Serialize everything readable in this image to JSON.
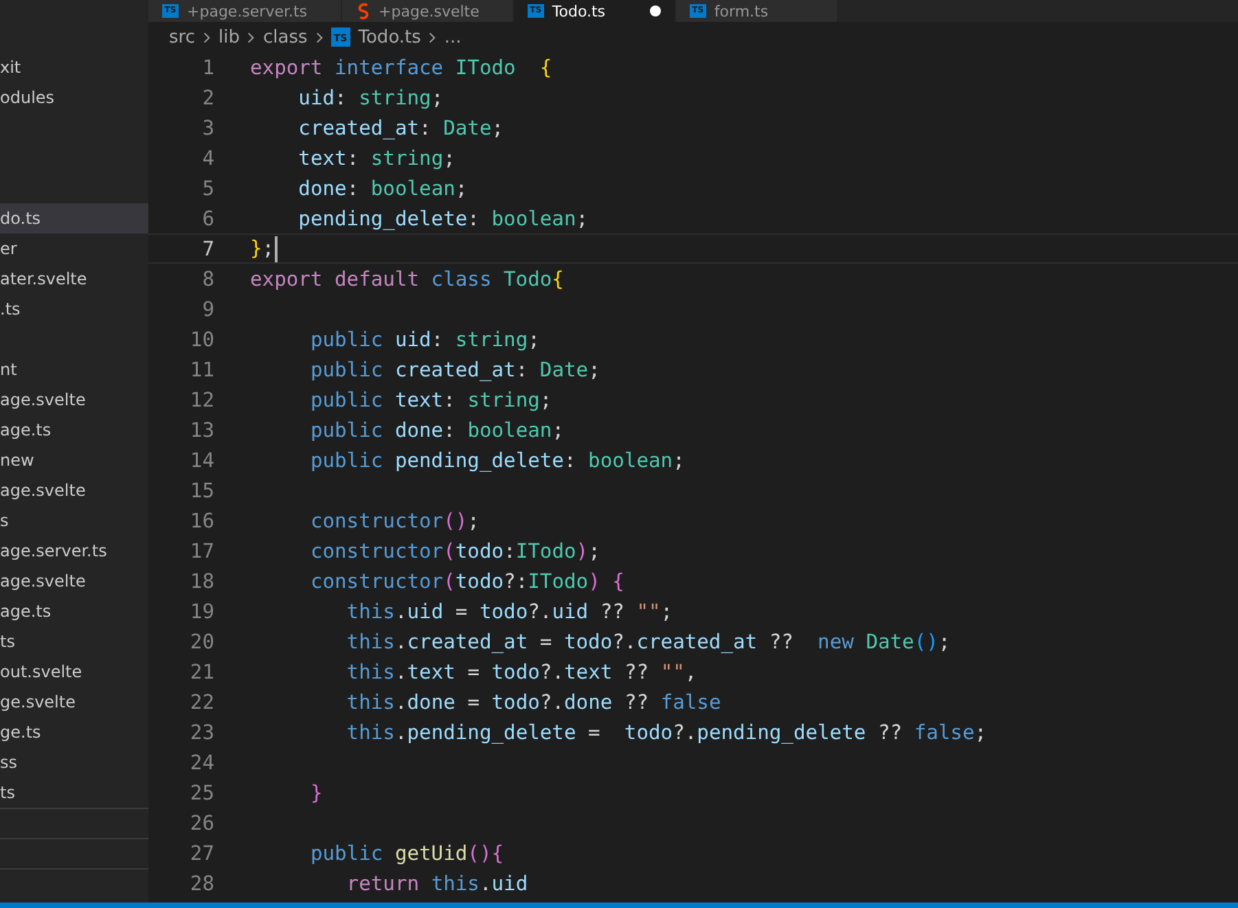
{
  "tabs": [
    {
      "label": "+page.server.ts",
      "kind": "ts",
      "icon_label": "TS",
      "selected": false,
      "modified": false
    },
    {
      "label": "+page.svelte",
      "kind": "svelte",
      "selected": false,
      "modified": false
    },
    {
      "label": "Todo.ts",
      "kind": "ts",
      "icon_label": "TS",
      "selected": true,
      "modified": true
    },
    {
      "label": "form.ts",
      "kind": "ts",
      "icon_label": "TS",
      "selected": false,
      "modified": false
    }
  ],
  "breadcrumb": [
    {
      "label": "src",
      "kind": "folder"
    },
    {
      "label": "lib",
      "kind": "folder"
    },
    {
      "label": "class",
      "kind": "folder"
    },
    {
      "label": "Todo.ts",
      "kind": "ts",
      "icon_label": "TS"
    },
    {
      "label": "...",
      "kind": "more"
    }
  ],
  "sidebar": {
    "items": [
      {
        "kind": "file",
        "label": "xit",
        "selected": false
      },
      {
        "kind": "file",
        "label": "odules",
        "selected": false
      },
      {
        "kind": "blank"
      },
      {
        "kind": "blank"
      },
      {
        "kind": "blank"
      },
      {
        "kind": "file",
        "label": "do.ts",
        "selected": true
      },
      {
        "kind": "file",
        "label": "er",
        "selected": false
      },
      {
        "kind": "file",
        "label": "ater.svelte",
        "selected": false
      },
      {
        "kind": "file",
        "label": ".ts",
        "selected": false
      },
      {
        "kind": "blank"
      },
      {
        "kind": "file",
        "label": "nt",
        "selected": false
      },
      {
        "kind": "file",
        "label": "age.svelte",
        "selected": false
      },
      {
        "kind": "file",
        "label": "age.ts",
        "selected": false
      },
      {
        "kind": "file",
        "label": "new",
        "selected": false
      },
      {
        "kind": "file",
        "label": "age.svelte",
        "selected": false
      },
      {
        "kind": "file",
        "label": "s",
        "selected": false
      },
      {
        "kind": "file",
        "label": "age.server.ts",
        "selected": false
      },
      {
        "kind": "file",
        "label": "age.svelte",
        "selected": false
      },
      {
        "kind": "file",
        "label": "age.ts",
        "selected": false
      },
      {
        "kind": "file",
        "label": "ts",
        "selected": false
      },
      {
        "kind": "file",
        "label": "out.svelte",
        "selected": false
      },
      {
        "kind": "file",
        "label": "ge.svelte",
        "selected": false
      },
      {
        "kind": "file",
        "label": "ge.ts",
        "selected": false
      },
      {
        "kind": "file",
        "label": "ss",
        "selected": false
      },
      {
        "kind": "file",
        "label": "ts",
        "selected": false
      }
    ]
  },
  "editor": {
    "lines": [
      {
        "number": "1",
        "current": false,
        "tokens": [
          {
            "text": "export ",
            "kind": "ctrl"
          },
          {
            "text": "interface ",
            "kind": "kw"
          },
          {
            "text": "ITodo  ",
            "kind": "type"
          },
          {
            "text": "{",
            "kind": "brace1"
          }
        ]
      },
      {
        "number": "2",
        "current": false,
        "tokens": [
          {
            "text": "    uid",
            "kind": "prop"
          },
          {
            "text": ": ",
            "kind": "plain"
          },
          {
            "text": "string",
            "kind": "type"
          },
          {
            "text": ";",
            "kind": "plain"
          }
        ]
      },
      {
        "number": "3",
        "current": false,
        "tokens": [
          {
            "text": "    created_at",
            "kind": "prop"
          },
          {
            "text": ": ",
            "kind": "plain"
          },
          {
            "text": "Date",
            "kind": "type"
          },
          {
            "text": ";",
            "kind": "plain"
          }
        ]
      },
      {
        "number": "4",
        "current": false,
        "tokens": [
          {
            "text": "    text",
            "kind": "prop"
          },
          {
            "text": ": ",
            "kind": "plain"
          },
          {
            "text": "string",
            "kind": "type"
          },
          {
            "text": ";",
            "kind": "plain"
          }
        ]
      },
      {
        "number": "5",
        "current": false,
        "tokens": [
          {
            "text": "    done",
            "kind": "prop"
          },
          {
            "text": ": ",
            "kind": "plain"
          },
          {
            "text": "boolean",
            "kind": "type"
          },
          {
            "text": ";",
            "kind": "plain"
          }
        ]
      },
      {
        "number": "6",
        "current": false,
        "tokens": [
          {
            "text": "    pending_delete",
            "kind": "prop"
          },
          {
            "text": ": ",
            "kind": "plain"
          },
          {
            "text": "boolean",
            "kind": "type"
          },
          {
            "text": ";",
            "kind": "plain"
          }
        ]
      },
      {
        "number": "7",
        "current": true,
        "tokens": [
          {
            "text": "}",
            "kind": "brace1"
          },
          {
            "text": ";",
            "kind": "plain"
          }
        ]
      },
      {
        "number": "8",
        "current": false,
        "tokens": [
          {
            "text": "export default ",
            "kind": "ctrl"
          },
          {
            "text": "class ",
            "kind": "kw"
          },
          {
            "text": "Todo",
            "kind": "type"
          },
          {
            "text": "{",
            "kind": "brace1"
          }
        ]
      },
      {
        "number": "9",
        "current": false
      },
      {
        "number": "10",
        "current": false,
        "tokens": [
          {
            "text": "     public ",
            "kind": "kw"
          },
          {
            "text": "uid",
            "kind": "prop"
          },
          {
            "text": ": ",
            "kind": "plain"
          },
          {
            "text": "string",
            "kind": "type"
          },
          {
            "text": ";",
            "kind": "plain"
          }
        ]
      },
      {
        "number": "11",
        "current": false,
        "tokens": [
          {
            "text": "     public ",
            "kind": "kw"
          },
          {
            "text": "created_at",
            "kind": "prop"
          },
          {
            "text": ": ",
            "kind": "plain"
          },
          {
            "text": "Date",
            "kind": "type"
          },
          {
            "text": ";",
            "kind": "plain"
          }
        ]
      },
      {
        "number": "12",
        "current": false,
        "tokens": [
          {
            "text": "     public ",
            "kind": "kw"
          },
          {
            "text": "text",
            "kind": "prop"
          },
          {
            "text": ": ",
            "kind": "plain"
          },
          {
            "text": "string",
            "kind": "type"
          },
          {
            "text": ";",
            "kind": "plain"
          }
        ]
      },
      {
        "number": "13",
        "current": false,
        "tokens": [
          {
            "text": "     public ",
            "kind": "kw"
          },
          {
            "text": "done",
            "kind": "prop"
          },
          {
            "text": ": ",
            "kind": "plain"
          },
          {
            "text": "boolean",
            "kind": "type"
          },
          {
            "text": ";",
            "kind": "plain"
          }
        ]
      },
      {
        "number": "14",
        "current": false,
        "tokens": [
          {
            "text": "     public ",
            "kind": "kw"
          },
          {
            "text": "pending_delete",
            "kind": "prop"
          },
          {
            "text": ": ",
            "kind": "plain"
          },
          {
            "text": "boolean",
            "kind": "type"
          },
          {
            "text": ";",
            "kind": "plain"
          }
        ]
      },
      {
        "number": "15",
        "current": false
      },
      {
        "number": "16",
        "current": false,
        "tokens": [
          {
            "text": "     constructor",
            "kind": "kw"
          },
          {
            "text": "()",
            "kind": "brace2"
          },
          {
            "text": ";",
            "kind": "plain"
          }
        ]
      },
      {
        "number": "17",
        "current": false,
        "tokens": [
          {
            "text": "     constructor",
            "kind": "kw"
          },
          {
            "text": "(",
            "kind": "brace2"
          },
          {
            "text": "todo",
            "kind": "prop"
          },
          {
            "text": ":",
            "kind": "plain"
          },
          {
            "text": "ITodo",
            "kind": "type"
          },
          {
            "text": ")",
            "kind": "brace2"
          },
          {
            "text": ";",
            "kind": "plain"
          }
        ]
      },
      {
        "number": "18",
        "current": false,
        "tokens": [
          {
            "text": "     constructor",
            "kind": "kw"
          },
          {
            "text": "(",
            "kind": "brace2"
          },
          {
            "text": "todo",
            "kind": "prop"
          },
          {
            "text": "?:",
            "kind": "plain"
          },
          {
            "text": "ITodo",
            "kind": "type"
          },
          {
            "text": ") {",
            "kind": "brace2"
          }
        ]
      },
      {
        "number": "19",
        "current": false,
        "tokens": [
          {
            "text": "        this",
            "kind": "kw"
          },
          {
            "text": ".",
            "kind": "plain"
          },
          {
            "text": "uid",
            "kind": "prop"
          },
          {
            "text": " = ",
            "kind": "plain"
          },
          {
            "text": "todo",
            "kind": "prop"
          },
          {
            "text": "?.",
            "kind": "plain"
          },
          {
            "text": "uid",
            "kind": "prop"
          },
          {
            "text": " ?? ",
            "kind": "plain"
          },
          {
            "text": "\"\"",
            "kind": "str"
          },
          {
            "text": ";",
            "kind": "plain"
          }
        ]
      },
      {
        "number": "20",
        "current": false,
        "tokens": [
          {
            "text": "        this",
            "kind": "kw"
          },
          {
            "text": ".",
            "kind": "plain"
          },
          {
            "text": "created_at",
            "kind": "prop"
          },
          {
            "text": " = ",
            "kind": "plain"
          },
          {
            "text": "todo",
            "kind": "prop"
          },
          {
            "text": "?.",
            "kind": "plain"
          },
          {
            "text": "created_at",
            "kind": "prop"
          },
          {
            "text": " ??  ",
            "kind": "plain"
          },
          {
            "text": "new ",
            "kind": "kw"
          },
          {
            "text": "Date",
            "kind": "type"
          },
          {
            "text": "()",
            "kind": "brace3"
          },
          {
            "text": ";",
            "kind": "plain"
          }
        ]
      },
      {
        "number": "21",
        "current": false,
        "tokens": [
          {
            "text": "        this",
            "kind": "kw"
          },
          {
            "text": ".",
            "kind": "plain"
          },
          {
            "text": "text",
            "kind": "prop"
          },
          {
            "text": " = ",
            "kind": "plain"
          },
          {
            "text": "todo",
            "kind": "prop"
          },
          {
            "text": "?.",
            "kind": "plain"
          },
          {
            "text": "text",
            "kind": "prop"
          },
          {
            "text": " ?? ",
            "kind": "plain"
          },
          {
            "text": "\"\"",
            "kind": "str"
          },
          {
            "text": ",",
            "kind": "plain"
          }
        ]
      },
      {
        "number": "22",
        "current": false,
        "tokens": [
          {
            "text": "        this",
            "kind": "kw"
          },
          {
            "text": ".",
            "kind": "plain"
          },
          {
            "text": "done",
            "kind": "prop"
          },
          {
            "text": " = ",
            "kind": "plain"
          },
          {
            "text": "todo",
            "kind": "prop"
          },
          {
            "text": "?.",
            "kind": "plain"
          },
          {
            "text": "done",
            "kind": "prop"
          },
          {
            "text": " ?? ",
            "kind": "plain"
          },
          {
            "text": "false",
            "kind": "kw"
          }
        ]
      },
      {
        "number": "23",
        "current": false,
        "tokens": [
          {
            "text": "        this",
            "kind": "kw"
          },
          {
            "text": ".",
            "kind": "plain"
          },
          {
            "text": "pending_delete",
            "kind": "prop"
          },
          {
            "text": " =  ",
            "kind": "plain"
          },
          {
            "text": "todo",
            "kind": "prop"
          },
          {
            "text": "?.",
            "kind": "plain"
          },
          {
            "text": "pending_delete",
            "kind": "prop"
          },
          {
            "text": " ?? ",
            "kind": "plain"
          },
          {
            "text": "false",
            "kind": "kw"
          },
          {
            "text": ";",
            "kind": "plain"
          }
        ]
      },
      {
        "number": "24",
        "current": false
      },
      {
        "number": "25",
        "current": false,
        "tokens": [
          {
            "text": "     }",
            "kind": "brace2"
          }
        ]
      },
      {
        "number": "26",
        "current": false
      },
      {
        "number": "27",
        "current": false,
        "tokens": [
          {
            "text": "     public ",
            "kind": "kw"
          },
          {
            "text": "getUid",
            "kind": "func"
          },
          {
            "text": "()",
            "kind": "brace2"
          },
          {
            "text": "{",
            "kind": "brace2"
          }
        ]
      },
      {
        "number": "28",
        "current": false,
        "tokens": [
          {
            "text": "        return ",
            "kind": "ctrl"
          },
          {
            "text": "this",
            "kind": "kw"
          },
          {
            "text": ".",
            "kind": "plain"
          },
          {
            "text": "uid",
            "kind": "prop"
          }
        ]
      }
    ]
  }
}
